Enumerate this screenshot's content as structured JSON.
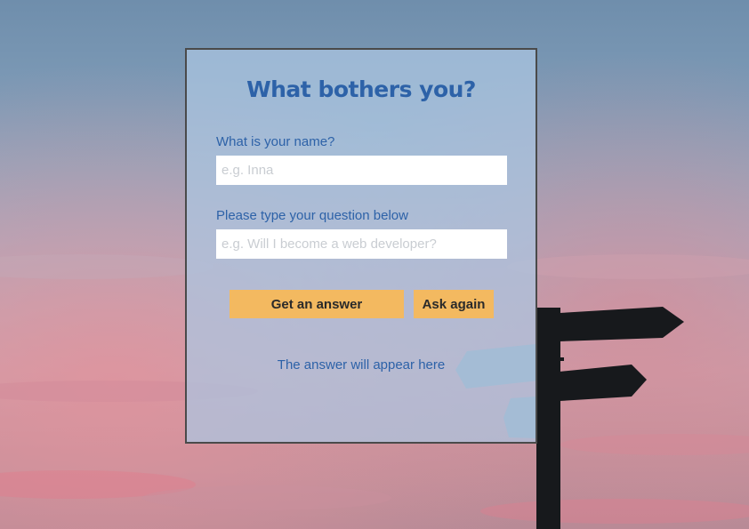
{
  "form": {
    "title": "What bothers you?",
    "name_label": "What is your name?",
    "name_placeholder": "e.g. Inna",
    "name_value": "",
    "question_label": "Please type your question below",
    "question_placeholder": "e.g. Will I become a web developer?",
    "question_value": "",
    "answer_button": "Get an answer",
    "ask_again_button": "Ask again",
    "answer_text": "The answer will appear here"
  },
  "colors": {
    "accent": "#2d62a8",
    "button": "#f3b960",
    "card_border": "#4a4a4a"
  },
  "icons": {
    "background": "signpost-sunset-image"
  }
}
